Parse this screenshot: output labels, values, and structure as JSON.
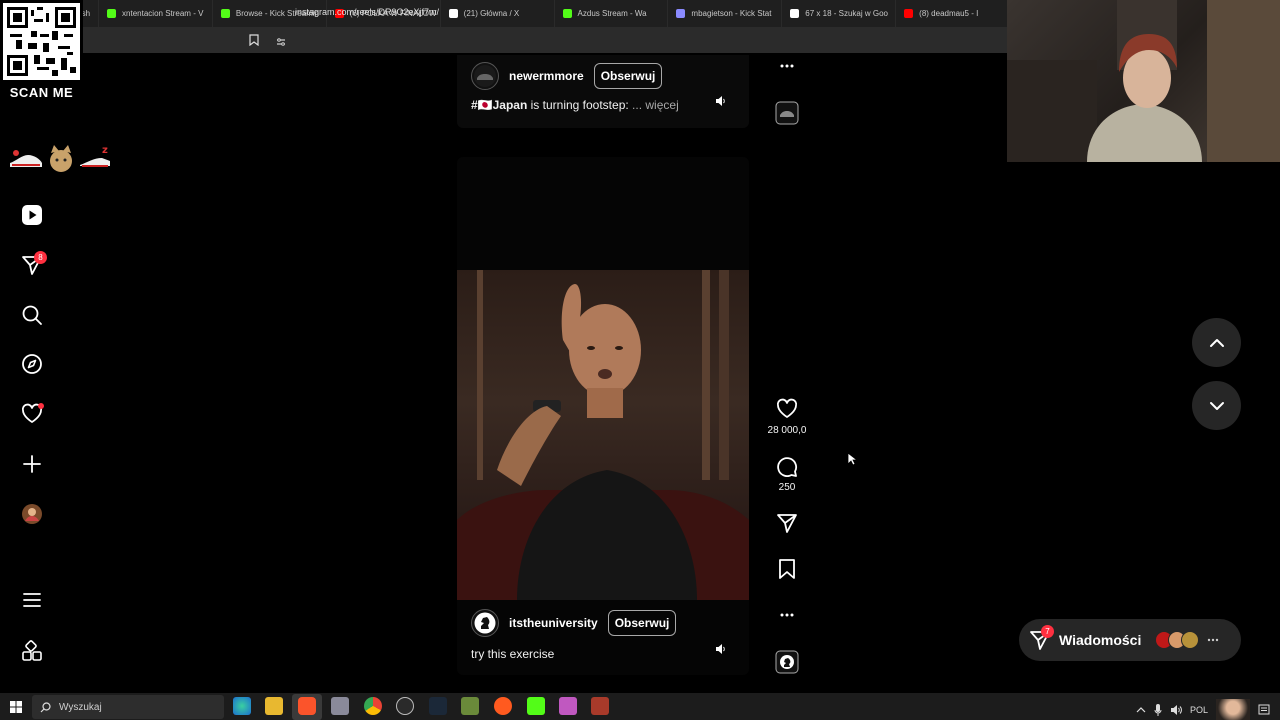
{
  "browser": {
    "tabs": [
      {
        "label": "Dash",
        "color": "#4a4a4a"
      },
      {
        "label": "xntentacion Stream - V",
        "color": "#53fc18"
      },
      {
        "label": "Browse - Kick Streamin",
        "color": "#53fc18"
      },
      {
        "label": "(6) POLKA W FINAŁOW",
        "color": "#ff0000"
      },
      {
        "label": "(21) Główna / X",
        "color": "#ffffff"
      },
      {
        "label": "Azdus Stream - Wa",
        "color": "#53fc18"
      },
      {
        "label": "mbagietson - Kick Stat",
        "color": "#8a8aff"
      },
      {
        "label": "67 x 18 - Szukaj w Goo",
        "color": "#ffffff"
      },
      {
        "label": "(8) deadmau5 - I",
        "color": "#ff0000"
      }
    ],
    "url": "instagram.com/reels/DR9O2eXjf7m/"
  },
  "qr": {
    "label": "SCAN ME"
  },
  "nav": {
    "notifications_badge": "8"
  },
  "reel_top": {
    "username": "newermmore",
    "follow_label": "Obserwuj",
    "hashtag": "#🇯🇵Japan",
    "caption": "is turning footstep:",
    "more_label": "... więcej"
  },
  "reel_main": {
    "username": "itstheuniversity",
    "follow_label": "Obserwuj",
    "caption": "try this exercise"
  },
  "actions": {
    "likes": "28 000,0",
    "comments": "250"
  },
  "messages": {
    "label": "Wiadomości",
    "badge": "7"
  },
  "taskbar": {
    "search_placeholder": "Wyszukaj",
    "lang": "POL"
  },
  "colors": {
    "accent_badge": "#ff3040",
    "surface": "#262626"
  }
}
